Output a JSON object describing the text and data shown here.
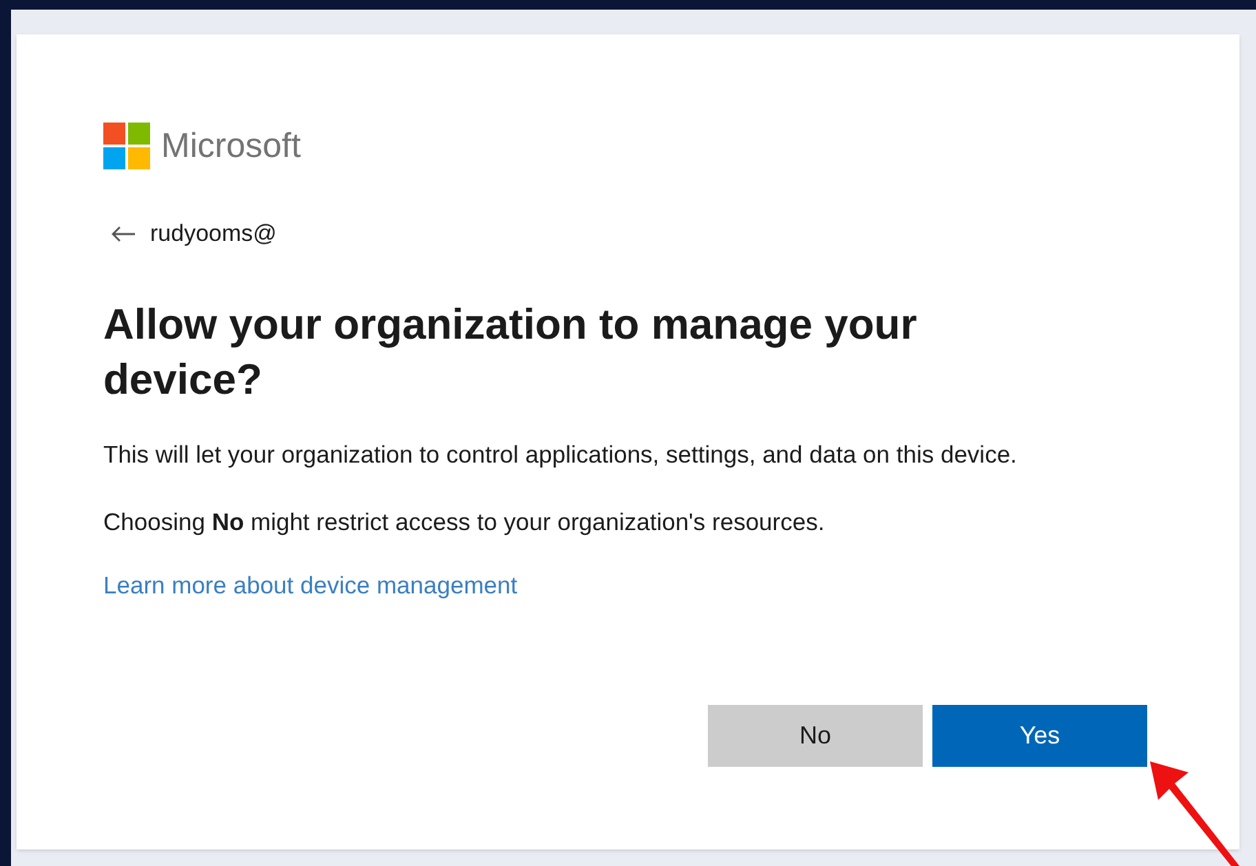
{
  "brand": {
    "name": "Microsoft"
  },
  "account": {
    "email": "rudyooms@"
  },
  "title": "Allow your organization to manage your device?",
  "paragraphs": [
    "This will let your organization to control applications, settings, and data on this device.",
    "Choosing **No** might restrict access to your organization's resources."
  ],
  "link": "Learn more about device management",
  "buttons": [
    {
      "label": "No",
      "kind": "secondary"
    },
    {
      "label": "Yes",
      "kind": "primary"
    }
  ]
}
